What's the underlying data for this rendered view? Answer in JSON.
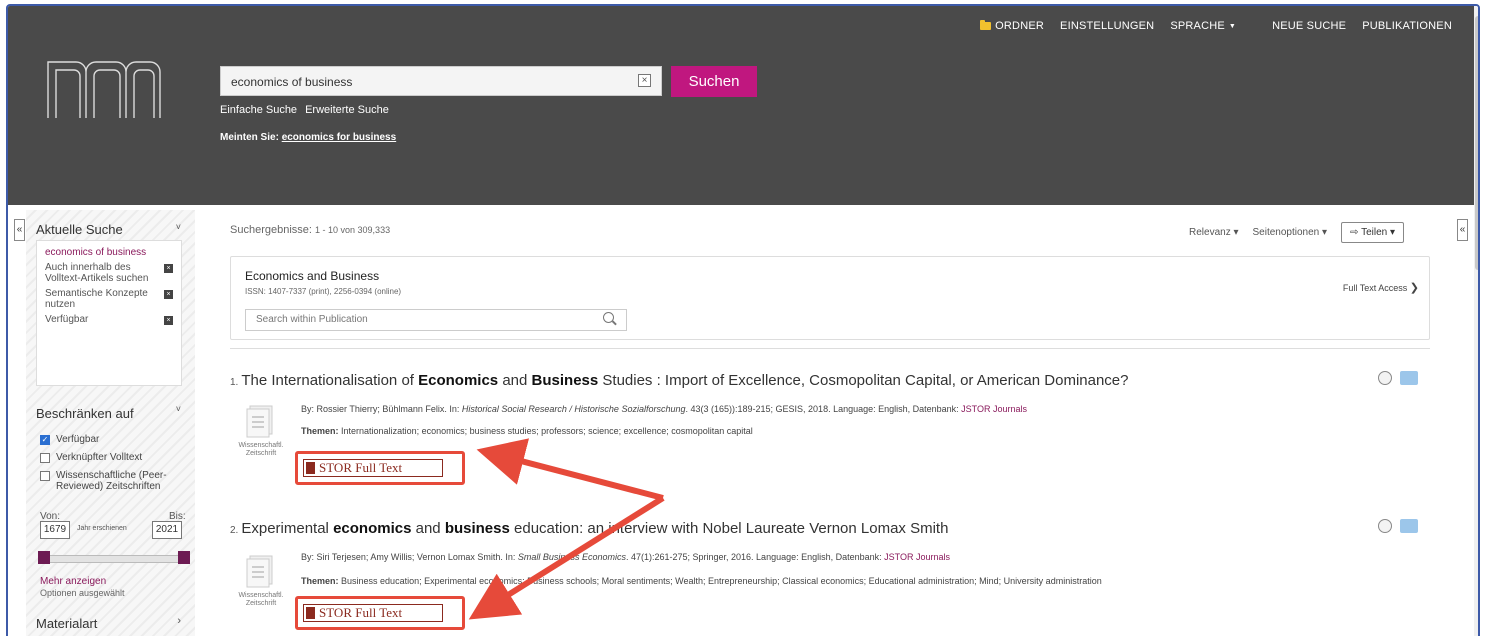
{
  "topnav": {
    "ordner": "ORDNER",
    "einstellungen": "EINSTELLUNGEN",
    "sprache": "SPRACHE",
    "neue_suche": "NEUE SUCHE",
    "publikationen": "PUBLIKATIONEN"
  },
  "search": {
    "query": "economics of business",
    "button": "Suchen",
    "simple": "Einfache Suche",
    "advanced": "Erweiterte Suche",
    "did_you_mean_label": "Meinten Sie:",
    "did_you_mean_value": "economics for business"
  },
  "sidebar": {
    "current_heading": "Aktuelle Suche",
    "current_term": "economics of business",
    "filters": [
      "Auch innerhalb des Volltext-Artikels suchen",
      "Semantische Konzepte nutzen",
      "Verfügbar"
    ],
    "limit_heading": "Beschränken auf",
    "checkboxes": [
      {
        "label": "Verfügbar",
        "checked": true
      },
      {
        "label": "Verknüpfter Volltext",
        "checked": false
      },
      {
        "label": "Wissenschaftliche (Peer-Reviewed) Zeitschriften",
        "checked": false
      }
    ],
    "from_label": "Von:",
    "to_label": "Bis:",
    "year_from": "1679",
    "year_mid": "Jahr erschienen",
    "year_to": "2021",
    "more": "Mehr anzeigen",
    "options_selected": "Optionen ausgewählt",
    "material_heading": "Materialart"
  },
  "results_header": {
    "label": "Suchergebnisse:",
    "range": "1 - 10 von 309,333",
    "sort": "Relevanz",
    "page_options": "Seitenoptionen",
    "share": "Teilen"
  },
  "publication": {
    "title": "Economics and Business",
    "issn": "ISSN: 1407-7337 (print), 2256-0394 (online)",
    "search_placeholder": "Search within Publication",
    "full_text_access": "Full Text Access"
  },
  "results": [
    {
      "num": "1.",
      "title_parts": [
        "The Internationalisation of ",
        "Economics",
        " and ",
        "Business",
        " Studies : Import of Excellence, Cosmopolitan Capital, or American Dominance?"
      ],
      "meta_prefix": "By: Rossier Thierry; Bühlmann Felix. In: ",
      "meta_source": "Historical Social Research / Historische Sozialforschung",
      "meta_suffix": ". 43(3 (165)):189-215; GESIS, 2018. Language: English, Datenbank: ",
      "meta_db": "JSTOR Journals",
      "themes_label": "Themen:",
      "themes": "Internationalization; economics; business studies; professors; science; excellence; cosmopolitan capital",
      "type": "Wissenschaftl. Zeitschrift",
      "fulltext": "STOR Full Text"
    },
    {
      "num": "2.",
      "title_parts": [
        "Experimental ",
        "economics",
        " and ",
        "business",
        " education: an interview with Nobel Laureate Vernon Lomax Smith"
      ],
      "meta_prefix": "By: Siri Terjesen; Amy Willis; Vernon Lomax Smith. In: ",
      "meta_source": "Small Business Economics",
      "meta_suffix": ". 47(1):261-275; Springer, 2016. Language: English, Datenbank: ",
      "meta_db": "JSTOR Journals",
      "themes_label": "Themen:",
      "themes": "Business education; Experimental economics; Business schools; Moral sentiments; Wealth; Entrepreneurship; Classical economics; Educational administration; Mind; University administration",
      "type": "Wissenschaftl. Zeitschrift",
      "fulltext": "STOR Full Text"
    }
  ],
  "colors": {
    "header_bg": "#4a4a4a",
    "accent": "#c0177f",
    "annotation": "#e64a3a"
  }
}
